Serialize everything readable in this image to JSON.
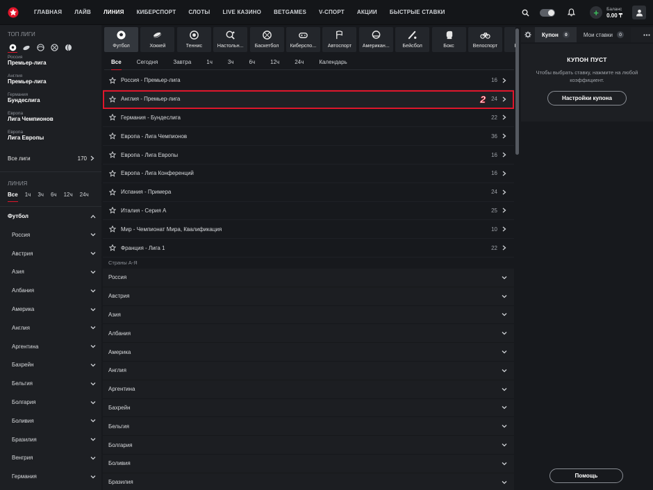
{
  "header": {
    "nav": [
      "ГЛАВНАЯ",
      "ЛАЙВ",
      "ЛИНИЯ",
      "КИБЕРСПОРТ",
      "СЛОТЫ",
      "LIVE КАЗИНО",
      "BETGAMES",
      "V-СПОРТ",
      "АКЦИИ",
      "БЫСТРЫЕ СТАВКИ"
    ],
    "active_nav": "ЛИНИЯ",
    "balance_label": "Баланс",
    "balance_value": "0.00 ₸",
    "icons": [
      "search-icon",
      "theme-toggle",
      "bell-icon",
      "plus-icon",
      "user-icon"
    ]
  },
  "sidebar": {
    "top_leagues_title": "ТОП ЛИГИ",
    "sport_icons": [
      "football-icon",
      "hockey-icon",
      "tennis-icon",
      "basketball-icon",
      "volleyball-icon"
    ],
    "top_leagues": [
      {
        "country": "Россия",
        "league": "Премьер-лига"
      },
      {
        "country": "Англия",
        "league": "Премьер-лига"
      },
      {
        "country": "Германия",
        "league": "Бундеслига"
      },
      {
        "country": "Европа",
        "league": "Лига Чемпионов"
      },
      {
        "country": "Европа",
        "league": "Лига Европы"
      }
    ],
    "all_leagues_label": "Все лиги",
    "all_leagues_count": "170",
    "line_title": "ЛИНИЯ",
    "periods": [
      "Все",
      "1ч",
      "3ч",
      "6ч",
      "12ч",
      "24ч"
    ],
    "sport": "Футбол",
    "countries": [
      "Россия",
      "Австрия",
      "Азия",
      "Албания",
      "Америка",
      "Англия",
      "Аргентина",
      "Бахрейн",
      "Бельгия",
      "Болгария",
      "Боливия",
      "Бразилия",
      "Венгрия",
      "Германия"
    ]
  },
  "sports_strip": [
    {
      "label": "Футбол",
      "icon": "football-icon"
    },
    {
      "label": "Хоккей",
      "icon": "hockey-icon"
    },
    {
      "label": "Теннис",
      "icon": "tennis-icon"
    },
    {
      "label": "Настольн...",
      "icon": "table-tennis-icon"
    },
    {
      "label": "Баскетбол",
      "icon": "basketball-icon"
    },
    {
      "label": "Киберспо...",
      "icon": "gamepad-icon"
    },
    {
      "label": "Автоспорт",
      "icon": "racing-flag-icon"
    },
    {
      "label": "Американ...",
      "icon": "american-football-icon"
    },
    {
      "label": "Бейсбол",
      "icon": "baseball-icon"
    },
    {
      "label": "Бокс",
      "icon": "boxing-glove-icon"
    },
    {
      "label": "Велоспорт",
      "icon": "bicycle-icon"
    },
    {
      "label": "Волей",
      "icon": "volleyball-icon"
    }
  ],
  "period_tabs": [
    "Все",
    "Сегодня",
    "Завтра",
    "1ч",
    "3ч",
    "6ч",
    "12ч",
    "24ч",
    "Календарь"
  ],
  "leagues": [
    {
      "name": "Россия - Премьер-лига",
      "count": "16"
    },
    {
      "name": "Англия - Премьер-лига",
      "count": "24",
      "marker": "2"
    },
    {
      "name": "Германия - Бундеслига",
      "count": "22"
    },
    {
      "name": "Европа - Лига Чемпионов",
      "count": "36"
    },
    {
      "name": "Европа - Лига Европы",
      "count": "16"
    },
    {
      "name": "Европа - Лига Конференций",
      "count": "16"
    },
    {
      "name": "Испания - Примера",
      "count": "24"
    },
    {
      "name": "Италия - Серия А",
      "count": "25"
    },
    {
      "name": "Мир - Чемпионат Мира, Квалификация",
      "count": "10"
    },
    {
      "name": "Франция - Лига 1",
      "count": "22"
    }
  ],
  "countries_label": "Страны А-Я",
  "countries": [
    "Россия",
    "Австрия",
    "Азия",
    "Албания",
    "Америка",
    "Англия",
    "Аргентина",
    "Бахрейн",
    "Бельгия",
    "Болгария",
    "Боливия",
    "Бразилия"
  ],
  "coupon": {
    "tab_coupon": "Купон",
    "tab_coupon_count": "0",
    "tab_bets": "Мои ставки",
    "tab_bets_count": "0",
    "empty_title": "КУПОН ПУСТ",
    "empty_message": "Чтобы выбрать ставку, нажмите на любой коэффициент.",
    "settings_button": "Настройки купона",
    "help_button": "Помощь"
  },
  "colors": {
    "accent": "#e0162b",
    "bg": "#17191d",
    "panel": "#1d1f23"
  }
}
